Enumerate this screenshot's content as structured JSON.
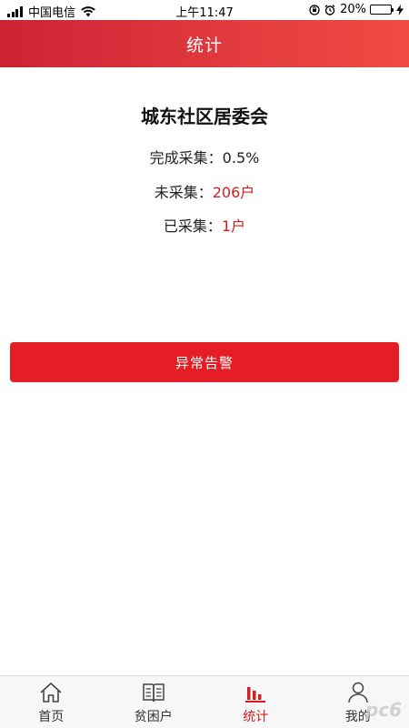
{
  "status_bar": {
    "carrier": "中国电信",
    "time": "上午11:47",
    "battery": "20%",
    "battery_level": 0.2
  },
  "nav": {
    "title": "统计"
  },
  "org": {
    "name": "城东社区居委会"
  },
  "stats": {
    "completed_label": "完成采集：",
    "completed_value": "0.5%",
    "uncollected_label": "未采集：",
    "uncollected_value": "206户",
    "collected_label": "已采集：",
    "collected_value": "1户"
  },
  "alert_button": "异常告警",
  "tabs": [
    {
      "label": "首页",
      "icon": "home-icon"
    },
    {
      "label": "贫困户",
      "icon": "book-icon"
    },
    {
      "label": "统计",
      "icon": "bar-chart-icon",
      "active": true
    },
    {
      "label": "我的",
      "icon": "person-icon"
    }
  ],
  "colors": {
    "accent": "#e41e24",
    "nav_start": "#cc2335",
    "nav_end": "#ef4b41"
  },
  "watermark": "pc6"
}
